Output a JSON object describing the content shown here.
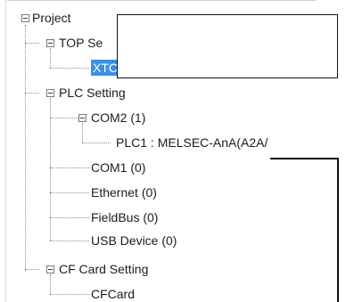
{
  "tree": {
    "project": "Project",
    "top_setting": "TOP Se",
    "xtop": "XTC",
    "plc_setting": "PLC Setting",
    "com2": "COM2 (1)",
    "plc1": "PLC1 : MELSEC-AnA(A2A/",
    "com1": "COM1 (0)",
    "ethernet": "Ethernet (0)",
    "fieldbus": "FieldBus (0)",
    "usb": "USB Device (0)",
    "cf_card_setting": "CF Card Setting",
    "cfcard": "CFCard"
  },
  "colors": {
    "selection": "#3d8fe3",
    "callout": "#111111"
  }
}
